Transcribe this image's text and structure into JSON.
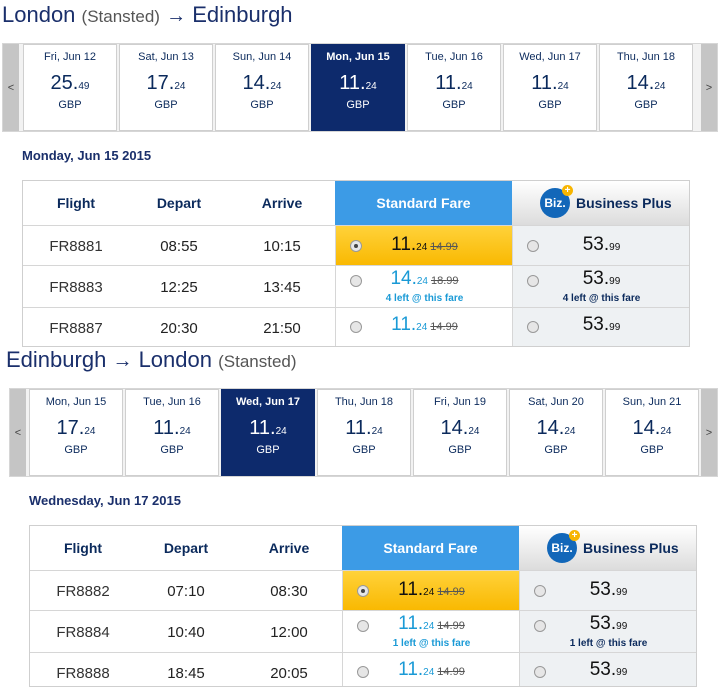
{
  "outbound": {
    "route_from": "London",
    "route_from_airport": "(Stansted)",
    "route_arrow": "→",
    "route_to": "Edinburgh",
    "nav_prev": "<",
    "nav_next": ">",
    "days": [
      {
        "label": "Fri, Jun 12",
        "price_int": "25.",
        "price_dec": "49",
        "currency": "GBP"
      },
      {
        "label": "Sat, Jun 13",
        "price_int": "17.",
        "price_dec": "24",
        "currency": "GBP"
      },
      {
        "label": "Sun, Jun 14",
        "price_int": "14.",
        "price_dec": "24",
        "currency": "GBP"
      },
      {
        "label": "Mon, Jun 15",
        "price_int": "11.",
        "price_dec": "24",
        "currency": "GBP"
      },
      {
        "label": "Tue, Jun 16",
        "price_int": "11.",
        "price_dec": "24",
        "currency": "GBP"
      },
      {
        "label": "Wed, Jun 17",
        "price_int": "11.",
        "price_dec": "24",
        "currency": "GBP"
      },
      {
        "label": "Thu, Jun 18",
        "price_int": "14.",
        "price_dec": "24",
        "currency": "GBP"
      }
    ],
    "selected_date": "Monday, Jun 15 2015",
    "headers": {
      "flight": "Flight",
      "depart": "Depart",
      "arrive": "Arrive",
      "standard": "Standard Fare",
      "biz_logo": "Biz.",
      "biz_plus_sign": "+",
      "business": "Business Plus"
    },
    "flights": [
      {
        "flight": "FR8881",
        "depart": "08:55",
        "arrive": "10:15",
        "std_int": "11.",
        "std_dec": "24",
        "std_old": "14.",
        "std_old_dec": "99",
        "std_left": "",
        "biz_int": "53.",
        "biz_dec": "99",
        "biz_left": ""
      },
      {
        "flight": "FR8883",
        "depart": "12:25",
        "arrive": "13:45",
        "std_int": "14.",
        "std_dec": "24",
        "std_old": "18.",
        "std_old_dec": "99",
        "std_left": "4 left @ this fare",
        "biz_int": "53.",
        "biz_dec": "99",
        "biz_left": "4 left @ this fare"
      },
      {
        "flight": "FR8887",
        "depart": "20:30",
        "arrive": "21:50",
        "std_int": "11.",
        "std_dec": "24",
        "std_old": "14.",
        "std_old_dec": "99",
        "std_left": "",
        "biz_int": "53.",
        "biz_dec": "99",
        "biz_left": ""
      }
    ]
  },
  "inbound": {
    "route_from": "Edinburgh",
    "route_arrow": "→",
    "route_to": "London",
    "route_to_airport": "(Stansted)",
    "nav_prev": "<",
    "nav_next": ">",
    "days": [
      {
        "label": "Mon, Jun 15",
        "price_int": "17.",
        "price_dec": "24",
        "currency": "GBP"
      },
      {
        "label": "Tue, Jun 16",
        "price_int": "11.",
        "price_dec": "24",
        "currency": "GBP"
      },
      {
        "label": "Wed, Jun 17",
        "price_int": "11.",
        "price_dec": "24",
        "currency": "GBP"
      },
      {
        "label": "Thu, Jun 18",
        "price_int": "11.",
        "price_dec": "24",
        "currency": "GBP"
      },
      {
        "label": "Fri, Jun 19",
        "price_int": "14.",
        "price_dec": "24",
        "currency": "GBP"
      },
      {
        "label": "Sat, Jun 20",
        "price_int": "14.",
        "price_dec": "24",
        "currency": "GBP"
      },
      {
        "label": "Sun, Jun 21",
        "price_int": "14.",
        "price_dec": "24",
        "currency": "GBP"
      }
    ],
    "selected_date": "Wednesday, Jun 17 2015",
    "headers": {
      "flight": "Flight",
      "depart": "Depart",
      "arrive": "Arrive",
      "standard": "Standard Fare",
      "biz_logo": "Biz.",
      "biz_plus_sign": "+",
      "business": "Business Plus"
    },
    "flights": [
      {
        "flight": "FR8882",
        "depart": "07:10",
        "arrive": "08:30",
        "std_int": "11.",
        "std_dec": "24",
        "std_old": "14.",
        "std_old_dec": "99",
        "std_left": "",
        "biz_int": "53.",
        "biz_dec": "99",
        "biz_left": ""
      },
      {
        "flight": "FR8884",
        "depart": "10:40",
        "arrive": "12:00",
        "std_int": "11.",
        "std_dec": "24",
        "std_old": "14.",
        "std_old_dec": "99",
        "std_left": "1 left @ this fare",
        "biz_int": "53.",
        "biz_dec": "99",
        "biz_left": "1 left @ this fare"
      },
      {
        "flight": "FR8888",
        "depart": "18:45",
        "arrive": "20:05",
        "std_int": "11.",
        "std_dec": "24",
        "std_old": "14.",
        "std_old_dec": "99",
        "std_left": "",
        "biz_int": "53.",
        "biz_dec": "99",
        "biz_left": ""
      }
    ]
  },
  "colors": {
    "selected_day": "#0d2a6c",
    "standard_header": "#3c9be6",
    "selected_fare": "#f9b800",
    "fare_blue": "#1a9ad6"
  }
}
